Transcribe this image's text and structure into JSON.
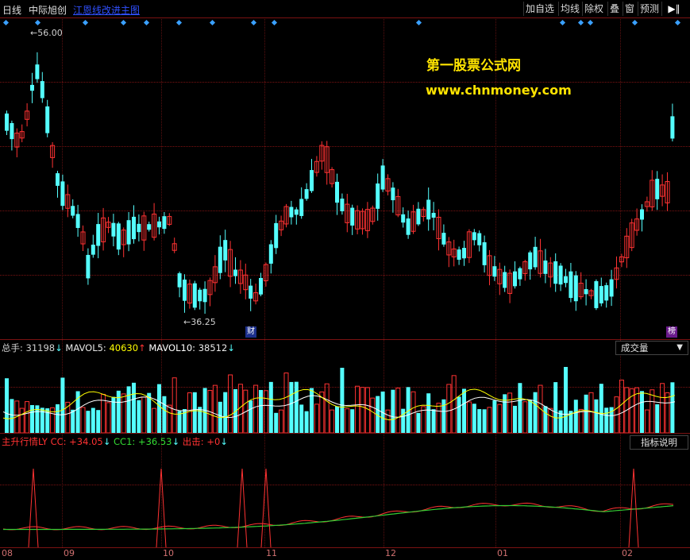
{
  "topbar": {
    "period": "日线",
    "stock_name": "中际旭创",
    "formula_link": "江恩线改进主图",
    "buttons": [
      "加自选",
      "均线",
      "除权",
      "叠",
      "窗",
      "预测"
    ],
    "nav_icon": "play-pause-icon"
  },
  "watermark": {
    "line1": "第一股票公式网",
    "line2": "www.chnmoney.com"
  },
  "price_pane": {
    "high_label": "56.00",
    "low_label": "36.25",
    "badge_cai": "财",
    "badge_bang": "榜"
  },
  "volume_pane": {
    "hdr_total_label": "总手:",
    "hdr_total_value": "31198",
    "hdr_mavol5_label": "MAVOL5:",
    "hdr_mavol5_value": "40630",
    "hdr_mavol10_label": "MAVOL10:",
    "hdr_mavol10_value": "38512",
    "dropdown_label": "成交量"
  },
  "indicator_pane": {
    "name": "主升行情LY",
    "cc_label": "CC:",
    "cc_value": "+34.05",
    "cc1_label": "CC1:",
    "cc1_value": "+36.53",
    "out_label": "出击:",
    "out_value": "+0",
    "help_button": "指标说明"
  },
  "x_axis": {
    "labels": [
      "08",
      "09",
      "10",
      "11",
      "12",
      "01",
      "02"
    ]
  },
  "colors": {
    "up": "#ff3232",
    "down": "#54ffff",
    "grid": "#7a1212",
    "ma_white": "#ffffff",
    "ma_yellow": "#ffff00",
    "cc_line": "#ff3232",
    "cc1_line": "#33cc33",
    "diamond": "#3aa0ff",
    "watermark": "#ffe400"
  },
  "chart_data": {
    "type": "candlestick",
    "x_axis_labels": [
      "08",
      "09",
      "10",
      "11",
      "12",
      "01",
      "02"
    ],
    "price_marks": {
      "high": 56.0,
      "low": 36.25
    },
    "volume": {
      "total": 31198,
      "mavol5": 40630,
      "mavol10": 38512
    },
    "indicator": {
      "cc": 34.05,
      "cc1": 36.53,
      "out": 0
    }
  }
}
